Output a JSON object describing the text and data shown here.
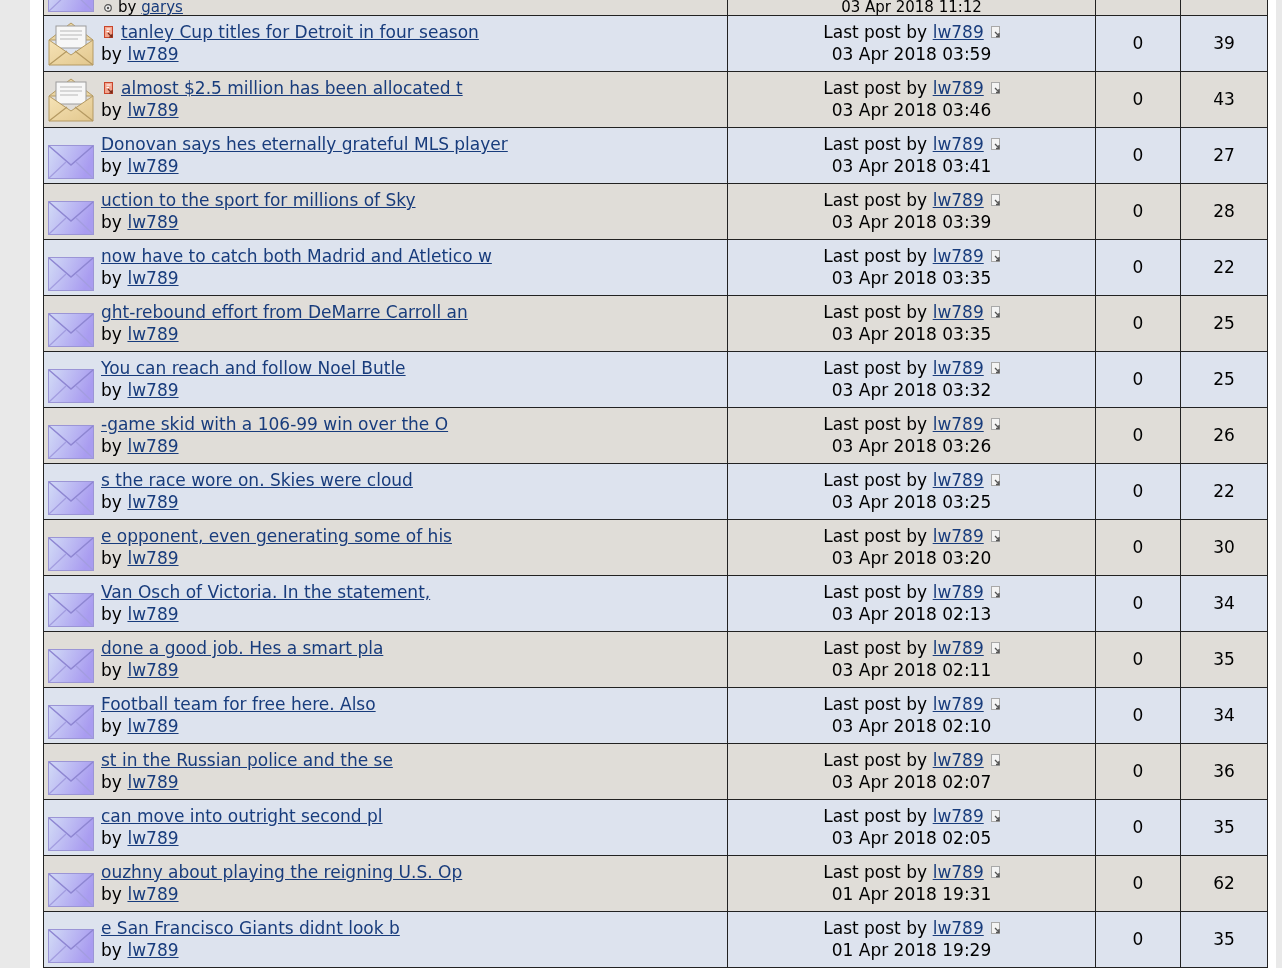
{
  "partial_row": {
    "small_icon": true,
    "by_label": "by",
    "author": "garys",
    "last_post_time": "03 Apr 2018 11:12"
  },
  "topics": [
    {
      "title": "tanley Cup titles for Detroit in four season",
      "unread": true,
      "by_label": "by",
      "author": "lw789",
      "last_post_label": "Last post by",
      "last_post_author": "lw789",
      "last_post_time": "03 Apr 2018 03:59",
      "replies": "0",
      "views": "39"
    },
    {
      "title": "almost $2.5 million has been allocated t",
      "unread": true,
      "by_label": "by",
      "author": "lw789",
      "last_post_label": "Last post by",
      "last_post_author": "lw789",
      "last_post_time": "03 Apr 2018 03:46",
      "replies": "0",
      "views": "43"
    },
    {
      "title": "Donovan says hes eternally grateful MLS player",
      "unread": false,
      "by_label": "by",
      "author": "lw789",
      "last_post_label": "Last post by",
      "last_post_author": "lw789",
      "last_post_time": "03 Apr 2018 03:41",
      "replies": "0",
      "views": "27"
    },
    {
      "title": "uction to the sport for millions of Sky",
      "unread": false,
      "by_label": "by",
      "author": "lw789",
      "last_post_label": "Last post by",
      "last_post_author": "lw789",
      "last_post_time": "03 Apr 2018 03:39",
      "replies": "0",
      "views": "28"
    },
    {
      "title": "now have to catch both Madrid and Atletico w",
      "unread": false,
      "by_label": "by",
      "author": "lw789",
      "last_post_label": "Last post by",
      "last_post_author": "lw789",
      "last_post_time": "03 Apr 2018 03:35",
      "replies": "0",
      "views": "22"
    },
    {
      "title": "ght-rebound effort from DeMarre Carroll an",
      "unread": false,
      "by_label": "by",
      "author": "lw789",
      "last_post_label": "Last post by",
      "last_post_author": "lw789",
      "last_post_time": "03 Apr 2018 03:35",
      "replies": "0",
      "views": "25"
    },
    {
      "title": "You can reach and follow Noel Butle",
      "unread": false,
      "by_label": "by",
      "author": "lw789",
      "last_post_label": "Last post by",
      "last_post_author": "lw789",
      "last_post_time": "03 Apr 2018 03:32",
      "replies": "0",
      "views": "25"
    },
    {
      "title": "-game skid with a 106-99 win over the O",
      "unread": false,
      "by_label": "by",
      "author": "lw789",
      "last_post_label": "Last post by",
      "last_post_author": "lw789",
      "last_post_time": "03 Apr 2018 03:26",
      "replies": "0",
      "views": "26"
    },
    {
      "title": "s the race wore on. Skies were cloud",
      "unread": false,
      "by_label": "by",
      "author": "lw789",
      "last_post_label": "Last post by",
      "last_post_author": "lw789",
      "last_post_time": "03 Apr 2018 03:25",
      "replies": "0",
      "views": "22"
    },
    {
      "title": "e opponent, even generating some of his",
      "unread": false,
      "by_label": "by",
      "author": "lw789",
      "last_post_label": "Last post by",
      "last_post_author": "lw789",
      "last_post_time": "03 Apr 2018 03:20",
      "replies": "0",
      "views": "30"
    },
    {
      "title": "Van Osch of Victoria. In the statement,",
      "unread": false,
      "by_label": "by",
      "author": "lw789",
      "last_post_label": "Last post by",
      "last_post_author": "lw789",
      "last_post_time": "03 Apr 2018 02:13",
      "replies": "0",
      "views": "34"
    },
    {
      "title": "done a good job. Hes a smart pla",
      "unread": false,
      "by_label": "by",
      "author": "lw789",
      "last_post_label": "Last post by",
      "last_post_author": "lw789",
      "last_post_time": "03 Apr 2018 02:11",
      "replies": "0",
      "views": "35"
    },
    {
      "title": "Football team for free here. Also",
      "unread": false,
      "by_label": "by",
      "author": "lw789",
      "last_post_label": "Last post by",
      "last_post_author": "lw789",
      "last_post_time": "03 Apr 2018 02:10",
      "replies": "0",
      "views": "34"
    },
    {
      "title": "st in the Russian police and the se",
      "unread": false,
      "by_label": "by",
      "author": "lw789",
      "last_post_label": "Last post by",
      "last_post_author": "lw789",
      "last_post_time": "03 Apr 2018 02:07",
      "replies": "0",
      "views": "36"
    },
    {
      "title": "can move into outright second pl",
      "unread": false,
      "by_label": "by",
      "author": "lw789",
      "last_post_label": "Last post by",
      "last_post_author": "lw789",
      "last_post_time": "03 Apr 2018 02:05",
      "replies": "0",
      "views": "35"
    },
    {
      "title": "ouzhny about playing the reigning U.S. Op",
      "unread": false,
      "by_label": "by",
      "author": "lw789",
      "last_post_label": "Last post by",
      "last_post_author": "lw789",
      "last_post_time": "01 Apr 2018 19:31",
      "replies": "0",
      "views": "62"
    },
    {
      "title": "e San Francisco Giants didnt look b",
      "unread": false,
      "by_label": "by",
      "author": "lw789",
      "last_post_label": "Last post by",
      "last_post_author": "lw789",
      "last_post_time": "01 Apr 2018 19:29",
      "replies": "0",
      "views": "35"
    }
  ]
}
